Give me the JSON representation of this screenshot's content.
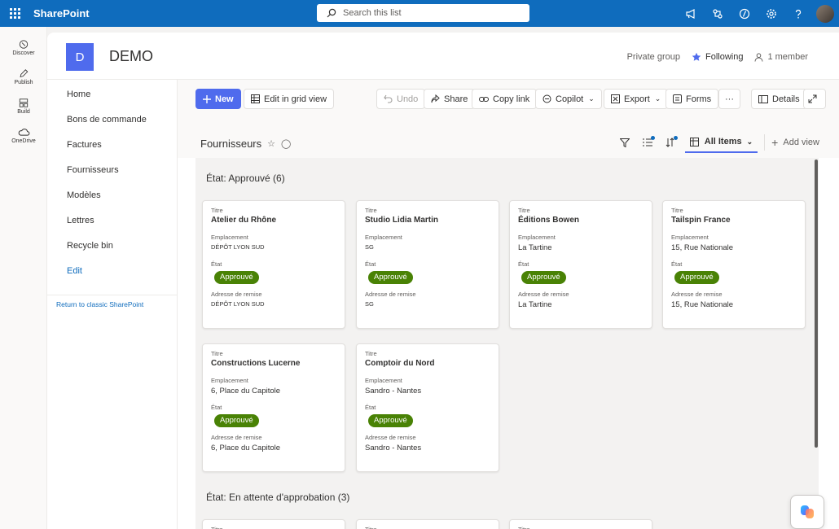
{
  "suitebar": {
    "brand": "SharePoint",
    "search_placeholder": "Search this list",
    "icons": [
      "megaphone-icon",
      "share-network-icon",
      "code-icon",
      "settings-gear-icon",
      "help-question-icon"
    ]
  },
  "rail": {
    "items": [
      {
        "label": "Discover",
        "icon": "compass-icon"
      },
      {
        "label": "Publish",
        "icon": "pen-icon"
      },
      {
        "label": "Build",
        "icon": "grid-build-icon"
      },
      {
        "label": "OneDrive",
        "icon": "cloud-icon"
      }
    ]
  },
  "site": {
    "logo_letter": "D",
    "title": "DEMO",
    "privacy": "Private group",
    "following": "Following",
    "members": "1 member"
  },
  "leftnav": {
    "items": [
      "Home",
      "Bons de commande",
      "Factures",
      "Fournisseurs",
      "Modèles",
      "Lettres",
      "Recycle bin",
      "Edit"
    ],
    "classic_link": "Return to classic SharePoint"
  },
  "commandbar": {
    "new": "New",
    "edit_grid": "Edit in grid view",
    "undo": "Undo",
    "share": "Share",
    "copy_link": "Copy link",
    "copilot": "Copilot",
    "export": "Export",
    "forms": "Forms",
    "more": "···",
    "details": "Details"
  },
  "listview": {
    "title": "Fournisseurs",
    "current_view": "All Items",
    "add_view": "Add view"
  },
  "fields": {
    "titre": "Titre",
    "emplacement": "Emplacement",
    "etat": "État",
    "adresse": "Adresse de remise"
  },
  "groups": [
    {
      "label": "État: Approuvé (6)",
      "cards": [
        {
          "titre": "Atelier du Rhône",
          "emplacement": "DÉPÔT LYON SUD",
          "etat": "Approuvé",
          "adresse": "DÉPÔT LYON SUD"
        },
        {
          "titre": "Studio Lidia Martin",
          "emplacement": "SG",
          "etat": "Approuvé",
          "adresse": "SG"
        },
        {
          "titre": "Éditions Bowen",
          "emplacement": "La Tartine",
          "etat": "Approuvé",
          "adresse": "La Tartine"
        },
        {
          "titre": "Tailspin France",
          "emplacement": "15, Rue Nationale",
          "etat": "Approuvé",
          "adresse": "15, Rue Nationale"
        },
        {
          "titre": "Constructions Lucerne",
          "emplacement": "6, Place du Capitole",
          "etat": "Approuvé",
          "adresse": "6, Place du Capitole"
        },
        {
          "titre": "Comptoir du Nord",
          "emplacement": "Sandro - Nantes",
          "etat": "Approuvé",
          "adresse": "Sandro - Nantes"
        }
      ]
    },
    {
      "label": "État: En attente d'approbation (3)",
      "cards": [
        {
          "titre_label": "Titre"
        },
        {
          "titre_label": "Titre"
        },
        {
          "titre_label": "Titre"
        }
      ]
    }
  ],
  "colors": {
    "suitebar": "#0f6cbd",
    "primary_button": "#4f6bed",
    "approved_badge": "#498205"
  }
}
